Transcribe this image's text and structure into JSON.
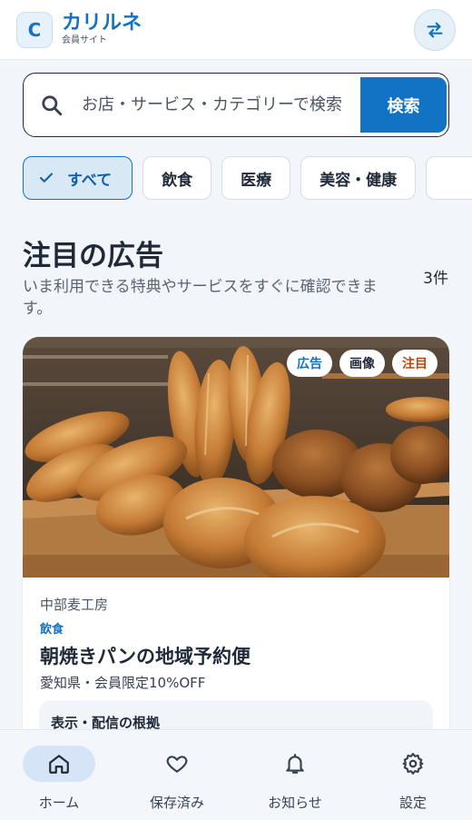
{
  "header": {
    "logo_letter": "C",
    "brand_name": "カリルネ",
    "brand_sub": "会員サイト",
    "switch_icon": "swap-arrows-icon"
  },
  "search": {
    "placeholder": "お店・サービス・カテゴリーで検索",
    "button_label": "検索"
  },
  "categories": [
    {
      "label": "すべて",
      "active": true
    },
    {
      "label": "飲食",
      "active": false
    },
    {
      "label": "医療",
      "active": false
    },
    {
      "label": "美容・健康",
      "active": false
    },
    {
      "label": "",
      "active": false
    }
  ],
  "section": {
    "title": "注目の広告",
    "description": "いま利用できる特典やサービスをすぐに確認できます。",
    "count": "3件"
  },
  "featured_card": {
    "badges": [
      "広告",
      "画像",
      "注目"
    ],
    "shop": "中部麦工房",
    "category": "飲食",
    "title": "朝焼きパンの地域予約便",
    "meta": "愛知県・会員限定10%OFF",
    "basis_title": "表示・配信の根拠"
  },
  "bottom_nav": [
    {
      "label": "ホーム",
      "icon": "home-icon",
      "active": true
    },
    {
      "label": "保存済み",
      "icon": "heart-icon",
      "active": false
    },
    {
      "label": "お知らせ",
      "icon": "bell-icon",
      "active": false
    },
    {
      "label": "設定",
      "icon": "gear-icon",
      "active": false
    }
  ],
  "colors": {
    "accent": "#1272c4",
    "background": "#f2f5f9",
    "hot_badge": "#c2410c"
  }
}
